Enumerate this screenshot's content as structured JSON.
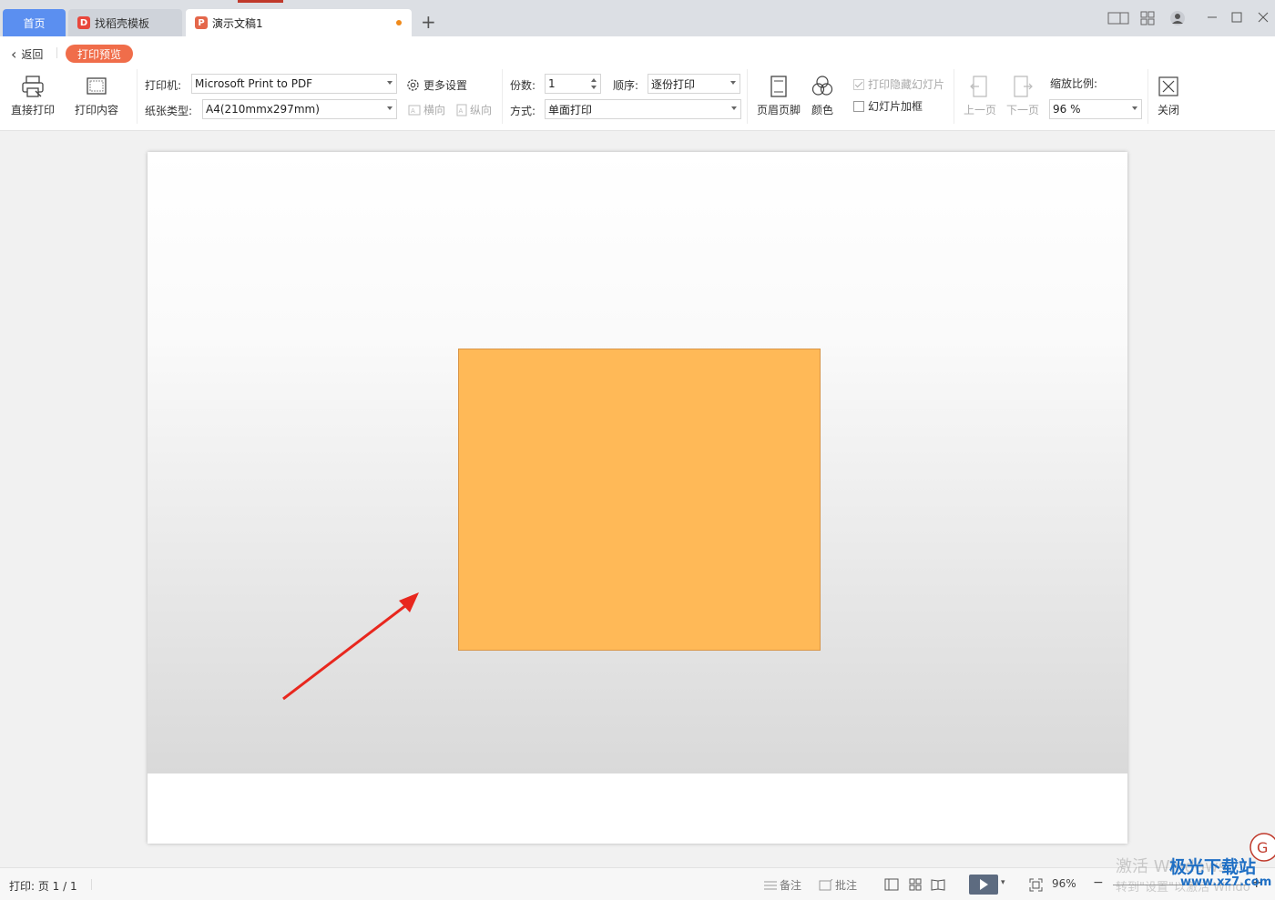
{
  "tabs": {
    "home": "首页",
    "template": "找稻壳模板",
    "document": "演示文稿1",
    "add": "+"
  },
  "toolbar": {
    "back": "返回",
    "print_preview": "打印预览",
    "direct_print": "直接打印",
    "print_content": "打印内容",
    "printer_label": "打印机:",
    "printer_value": "Microsoft Print to PDF",
    "more_settings": "更多设置",
    "paper_label": "纸张类型:",
    "paper_value": "A4(210mmx297mm)",
    "landscape": "横向",
    "portrait": "纵向",
    "copies_label": "份数:",
    "copies_value": "1",
    "order_label": "顺序:",
    "order_value": "逐份打印",
    "mode_label": "方式:",
    "mode_value": "单面打印",
    "header_footer": "页眉页脚",
    "color": "颜色",
    "print_hidden": "打印隐藏幻灯片",
    "frame_slides": "幻灯片加框",
    "prev_page": "上一页",
    "next_page": "下一页",
    "zoom_label": "缩放比例:",
    "zoom_value": "96 %",
    "close": "关闭"
  },
  "statusbar": {
    "print_page": "打印: 页 1 / 1",
    "notes": "备注",
    "comments": "批注",
    "zoom": "96%",
    "watermark_text": "激活 Windows",
    "watermark_sub": "转到\"设置\"以激活 Windo",
    "site_logo": "极光下载站",
    "site_url": "www.xz7.com"
  },
  "colors": {
    "accent_blue": "#5b8ff0",
    "badge_orange": "#f06d4a",
    "shape_orange": "#ffb957",
    "arrow_red": "#e8271e"
  }
}
